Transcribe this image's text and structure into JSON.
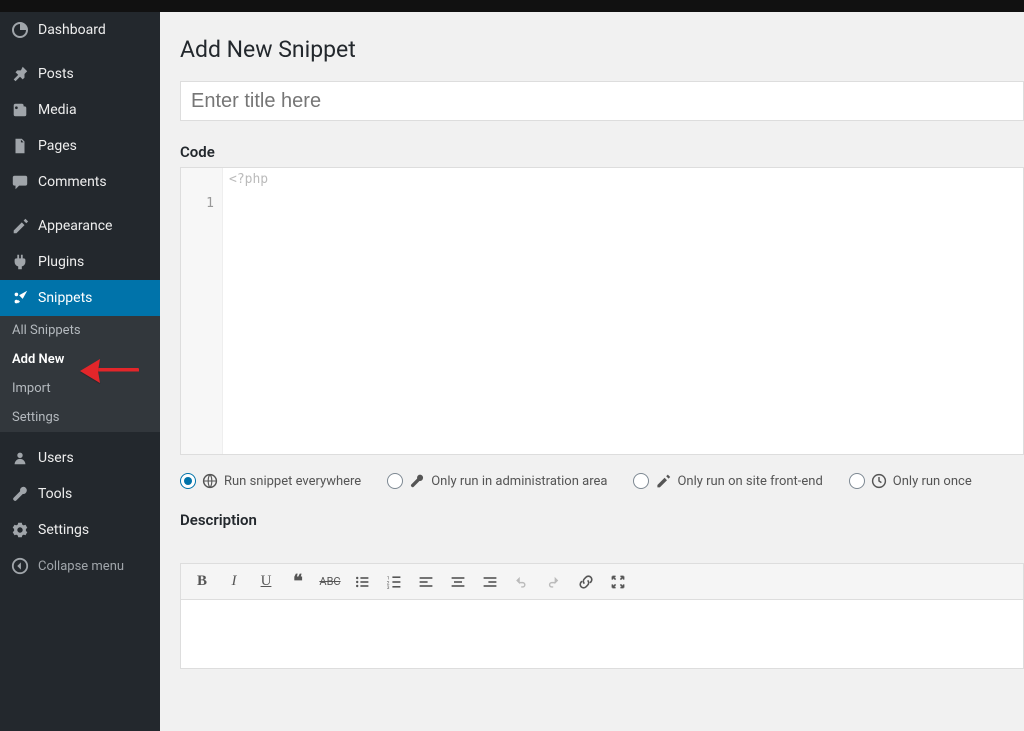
{
  "sidebar": {
    "items": [
      {
        "icon": "dashboard-icon",
        "label": "Dashboard"
      },
      {
        "icon": "pin-icon",
        "label": "Posts"
      },
      {
        "icon": "media-icon",
        "label": "Media"
      },
      {
        "icon": "page-icon",
        "label": "Pages"
      },
      {
        "icon": "comment-icon",
        "label": "Comments"
      },
      {
        "icon": "appearance-icon",
        "label": "Appearance"
      },
      {
        "icon": "plugin-icon",
        "label": "Plugins"
      },
      {
        "icon": "snippets-icon",
        "label": "Snippets"
      },
      {
        "icon": "users-icon",
        "label": "Users"
      },
      {
        "icon": "tools-icon",
        "label": "Tools"
      },
      {
        "icon": "settings-icon",
        "label": "Settings"
      }
    ],
    "submenu": [
      "All Snippets",
      "Add New",
      "Import",
      "Settings"
    ],
    "collapse_label": "Collapse menu"
  },
  "page": {
    "title": "Add New Snippet",
    "title_placeholder": "Enter title here",
    "code_label": "Code",
    "code_hint": "<?php",
    "code_line_number": "1",
    "description_label": "Description"
  },
  "scope": {
    "options": [
      {
        "label": "Run snippet everywhere"
      },
      {
        "label": "Only run in administration area"
      },
      {
        "label": "Only run on site front-end"
      },
      {
        "label": "Only run once"
      }
    ]
  },
  "toolbar": {
    "buttons": [
      "bold",
      "italic",
      "underline",
      "blockquote",
      "strikethrough",
      "bullet-list",
      "number-list",
      "align-left",
      "align-center",
      "align-right",
      "undo",
      "redo",
      "link",
      "fullscreen"
    ]
  }
}
